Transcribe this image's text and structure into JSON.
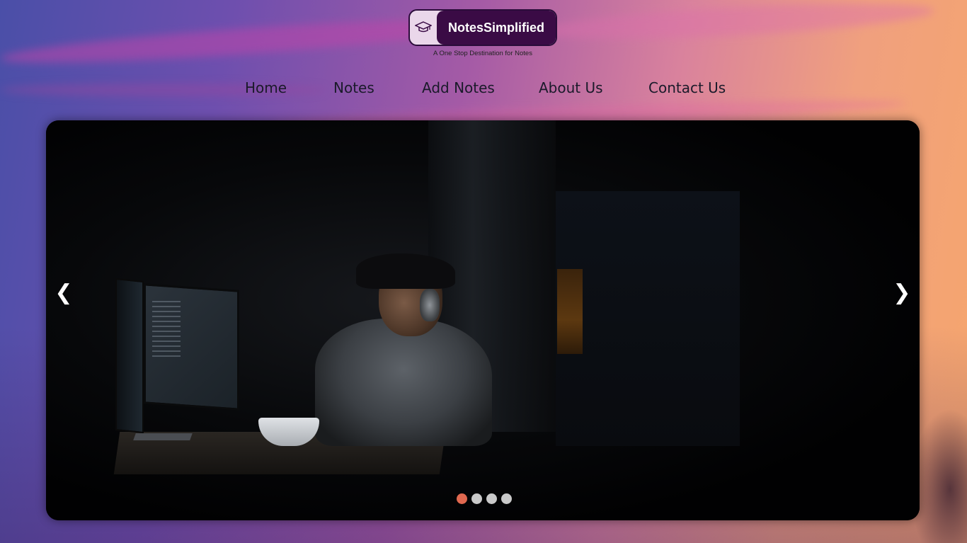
{
  "brand": {
    "name": "NotesSimplified",
    "tagline": "A One Stop Destination for Notes",
    "icon": "graduation-cap-icon"
  },
  "nav": {
    "items": [
      {
        "label": "Home"
      },
      {
        "label": "Notes"
      },
      {
        "label": "Add Notes"
      },
      {
        "label": "About Us"
      },
      {
        "label": "Contact Us"
      }
    ]
  },
  "carousel": {
    "prev_icon": "chevron-left-icon",
    "next_icon": "chevron-right-icon",
    "prev_glyph": "❮",
    "next_glyph": "❯",
    "slide_count": 4,
    "active_slide": 1,
    "image": "person-at-computer-dark-room"
  },
  "colors": {
    "brand_dark": "#3a0b45",
    "active_dot": "#e0684f",
    "inactive_dot": "#c9c9c9"
  }
}
